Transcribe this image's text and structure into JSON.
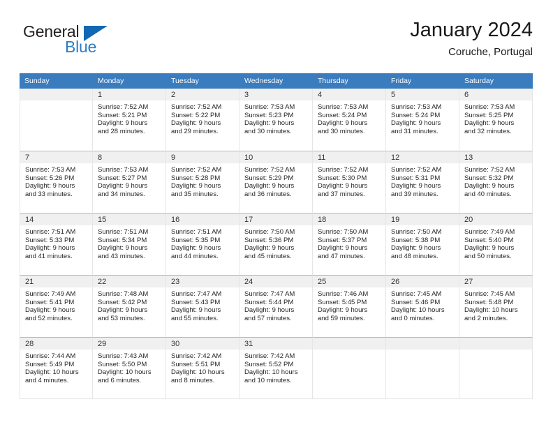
{
  "logo": {
    "word_top": "General",
    "word_bottom": "Blue",
    "icon": "triangle-mark"
  },
  "header": {
    "title": "January 2024",
    "subtitle": "Coruche, Portugal"
  },
  "colors": {
    "header_blue": "#3a7cbe",
    "daynum_band": "#f0f0f0",
    "logo_blue": "#2b7cc4",
    "text": "#1a1a1a"
  },
  "weekdays": [
    "Sunday",
    "Monday",
    "Tuesday",
    "Wednesday",
    "Thursday",
    "Friday",
    "Saturday"
  ],
  "weeks": [
    [
      {
        "day": "",
        "lines": []
      },
      {
        "day": "1",
        "lines": [
          "Sunrise: 7:52 AM",
          "Sunset: 5:21 PM",
          "Daylight: 9 hours",
          "and 28 minutes."
        ]
      },
      {
        "day": "2",
        "lines": [
          "Sunrise: 7:52 AM",
          "Sunset: 5:22 PM",
          "Daylight: 9 hours",
          "and 29 minutes."
        ]
      },
      {
        "day": "3",
        "lines": [
          "Sunrise: 7:53 AM",
          "Sunset: 5:23 PM",
          "Daylight: 9 hours",
          "and 30 minutes."
        ]
      },
      {
        "day": "4",
        "lines": [
          "Sunrise: 7:53 AM",
          "Sunset: 5:24 PM",
          "Daylight: 9 hours",
          "and 30 minutes."
        ]
      },
      {
        "day": "5",
        "lines": [
          "Sunrise: 7:53 AM",
          "Sunset: 5:24 PM",
          "Daylight: 9 hours",
          "and 31 minutes."
        ]
      },
      {
        "day": "6",
        "lines": [
          "Sunrise: 7:53 AM",
          "Sunset: 5:25 PM",
          "Daylight: 9 hours",
          "and 32 minutes."
        ]
      }
    ],
    [
      {
        "day": "7",
        "lines": [
          "Sunrise: 7:53 AM",
          "Sunset: 5:26 PM",
          "Daylight: 9 hours",
          "and 33 minutes."
        ]
      },
      {
        "day": "8",
        "lines": [
          "Sunrise: 7:53 AM",
          "Sunset: 5:27 PM",
          "Daylight: 9 hours",
          "and 34 minutes."
        ]
      },
      {
        "day": "9",
        "lines": [
          "Sunrise: 7:52 AM",
          "Sunset: 5:28 PM",
          "Daylight: 9 hours",
          "and 35 minutes."
        ]
      },
      {
        "day": "10",
        "lines": [
          "Sunrise: 7:52 AM",
          "Sunset: 5:29 PM",
          "Daylight: 9 hours",
          "and 36 minutes."
        ]
      },
      {
        "day": "11",
        "lines": [
          "Sunrise: 7:52 AM",
          "Sunset: 5:30 PM",
          "Daylight: 9 hours",
          "and 37 minutes."
        ]
      },
      {
        "day": "12",
        "lines": [
          "Sunrise: 7:52 AM",
          "Sunset: 5:31 PM",
          "Daylight: 9 hours",
          "and 39 minutes."
        ]
      },
      {
        "day": "13",
        "lines": [
          "Sunrise: 7:52 AM",
          "Sunset: 5:32 PM",
          "Daylight: 9 hours",
          "and 40 minutes."
        ]
      }
    ],
    [
      {
        "day": "14",
        "lines": [
          "Sunrise: 7:51 AM",
          "Sunset: 5:33 PM",
          "Daylight: 9 hours",
          "and 41 minutes."
        ]
      },
      {
        "day": "15",
        "lines": [
          "Sunrise: 7:51 AM",
          "Sunset: 5:34 PM",
          "Daylight: 9 hours",
          "and 43 minutes."
        ]
      },
      {
        "day": "16",
        "lines": [
          "Sunrise: 7:51 AM",
          "Sunset: 5:35 PM",
          "Daylight: 9 hours",
          "and 44 minutes."
        ]
      },
      {
        "day": "17",
        "lines": [
          "Sunrise: 7:50 AM",
          "Sunset: 5:36 PM",
          "Daylight: 9 hours",
          "and 45 minutes."
        ]
      },
      {
        "day": "18",
        "lines": [
          "Sunrise: 7:50 AM",
          "Sunset: 5:37 PM",
          "Daylight: 9 hours",
          "and 47 minutes."
        ]
      },
      {
        "day": "19",
        "lines": [
          "Sunrise: 7:50 AM",
          "Sunset: 5:38 PM",
          "Daylight: 9 hours",
          "and 48 minutes."
        ]
      },
      {
        "day": "20",
        "lines": [
          "Sunrise: 7:49 AM",
          "Sunset: 5:40 PM",
          "Daylight: 9 hours",
          "and 50 minutes."
        ]
      }
    ],
    [
      {
        "day": "21",
        "lines": [
          "Sunrise: 7:49 AM",
          "Sunset: 5:41 PM",
          "Daylight: 9 hours",
          "and 52 minutes."
        ]
      },
      {
        "day": "22",
        "lines": [
          "Sunrise: 7:48 AM",
          "Sunset: 5:42 PM",
          "Daylight: 9 hours",
          "and 53 minutes."
        ]
      },
      {
        "day": "23",
        "lines": [
          "Sunrise: 7:47 AM",
          "Sunset: 5:43 PM",
          "Daylight: 9 hours",
          "and 55 minutes."
        ]
      },
      {
        "day": "24",
        "lines": [
          "Sunrise: 7:47 AM",
          "Sunset: 5:44 PM",
          "Daylight: 9 hours",
          "and 57 minutes."
        ]
      },
      {
        "day": "25",
        "lines": [
          "Sunrise: 7:46 AM",
          "Sunset: 5:45 PM",
          "Daylight: 9 hours",
          "and 59 minutes."
        ]
      },
      {
        "day": "26",
        "lines": [
          "Sunrise: 7:45 AM",
          "Sunset: 5:46 PM",
          "Daylight: 10 hours",
          "and 0 minutes."
        ]
      },
      {
        "day": "27",
        "lines": [
          "Sunrise: 7:45 AM",
          "Sunset: 5:48 PM",
          "Daylight: 10 hours",
          "and 2 minutes."
        ]
      }
    ],
    [
      {
        "day": "28",
        "lines": [
          "Sunrise: 7:44 AM",
          "Sunset: 5:49 PM",
          "Daylight: 10 hours",
          "and 4 minutes."
        ]
      },
      {
        "day": "29",
        "lines": [
          "Sunrise: 7:43 AM",
          "Sunset: 5:50 PM",
          "Daylight: 10 hours",
          "and 6 minutes."
        ]
      },
      {
        "day": "30",
        "lines": [
          "Sunrise: 7:42 AM",
          "Sunset: 5:51 PM",
          "Daylight: 10 hours",
          "and 8 minutes."
        ]
      },
      {
        "day": "31",
        "lines": [
          "Sunrise: 7:42 AM",
          "Sunset: 5:52 PM",
          "Daylight: 10 hours",
          "and 10 minutes."
        ]
      },
      {
        "day": "",
        "lines": []
      },
      {
        "day": "",
        "lines": []
      },
      {
        "day": "",
        "lines": []
      }
    ]
  ]
}
